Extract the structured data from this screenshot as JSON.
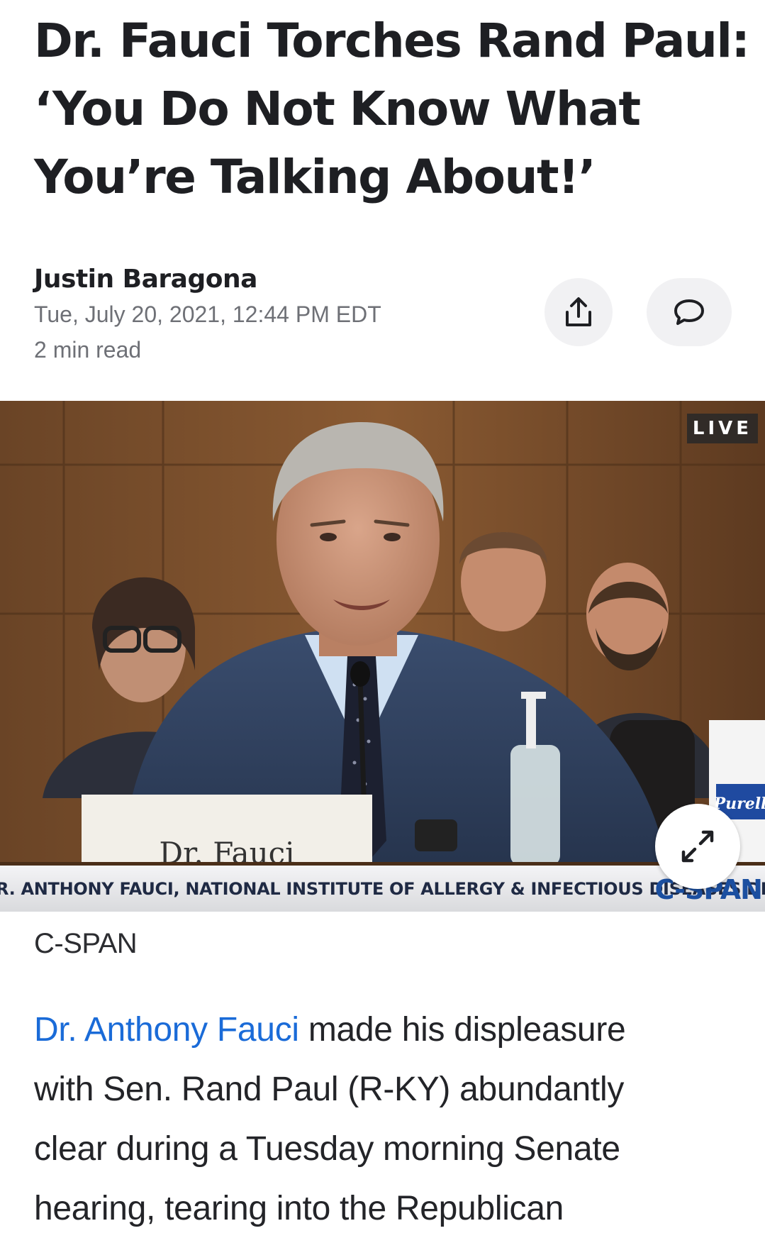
{
  "article": {
    "headline_lines": [
      "Dr. Fauci Torches Rand Paul:",
      "‘You Do Not Know What",
      "You’re Talking About!’"
    ],
    "author": "Justin Baragona",
    "published": "Tue, July 20, 2021, 12:44 PM EDT",
    "read_time": "2 min read"
  },
  "actions": {
    "share_icon": "share-icon",
    "comment_icon": "comment-icon"
  },
  "media": {
    "live_badge": "LIVE",
    "chyron": "R. ANTHONY FAUCI, NATIONAL INSTITUTE OF ALLERGY & INFECTIOUS DISEASES DIR.",
    "logo": "C-SPAN",
    "nameplate": "Dr. Fauci",
    "bottle_label": "Purell",
    "expand_icon": "expand-icon",
    "caption": "C-SPAN"
  },
  "body": {
    "link_text": "Dr. Anthony Fauci",
    "line1_rest": " made his displeasure",
    "line2": "with Sen. Rand Paul (R-KY) abundantly",
    "line3": "clear during a Tuesday morning Senate",
    "line4": "hearing, tearing into the Republican"
  },
  "colors": {
    "link": "#1a6bd8",
    "text": "#1e1f23",
    "meta": "#6e7076",
    "button_bg": "#f1f1f3",
    "cspan_blue": "#1b4fa0"
  }
}
